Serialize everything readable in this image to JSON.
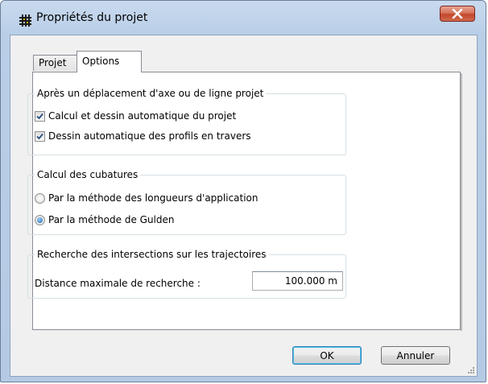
{
  "window": {
    "title": "Propriétés du projet"
  },
  "tabs": [
    {
      "label": "Projet",
      "active": false
    },
    {
      "label": "Options",
      "active": true
    }
  ],
  "groups": {
    "after_move": {
      "title": "Après un déplacement d'axe ou de ligne projet",
      "options": [
        {
          "label": "Calcul et dessin automatique du projet",
          "checked": true
        },
        {
          "label": "Dessin automatique des profils en travers",
          "checked": true
        }
      ]
    },
    "cubatures": {
      "title": "Calcul des cubatures",
      "options": [
        {
          "label": "Par la méthode des longueurs d'application",
          "selected": false
        },
        {
          "label": "Par la méthode de Gulden",
          "selected": true
        }
      ]
    },
    "intersections": {
      "title": "Recherche des intersections sur les trajectoires",
      "distance_label": "Distance maximale de recherche :",
      "distance_value": "100.000 m"
    }
  },
  "buttons": {
    "ok": "OK",
    "cancel": "Annuler"
  },
  "colors": {
    "title_bar": "#b9cfe8",
    "close_button": "#c3462b",
    "radio_dot": "#1b61b8",
    "default_button_border": "#3c7fb1"
  },
  "icons": {
    "app": "grid-app-icon",
    "close": "close-icon",
    "check": "checkmark-icon",
    "grip": "resize-grip-icon"
  }
}
